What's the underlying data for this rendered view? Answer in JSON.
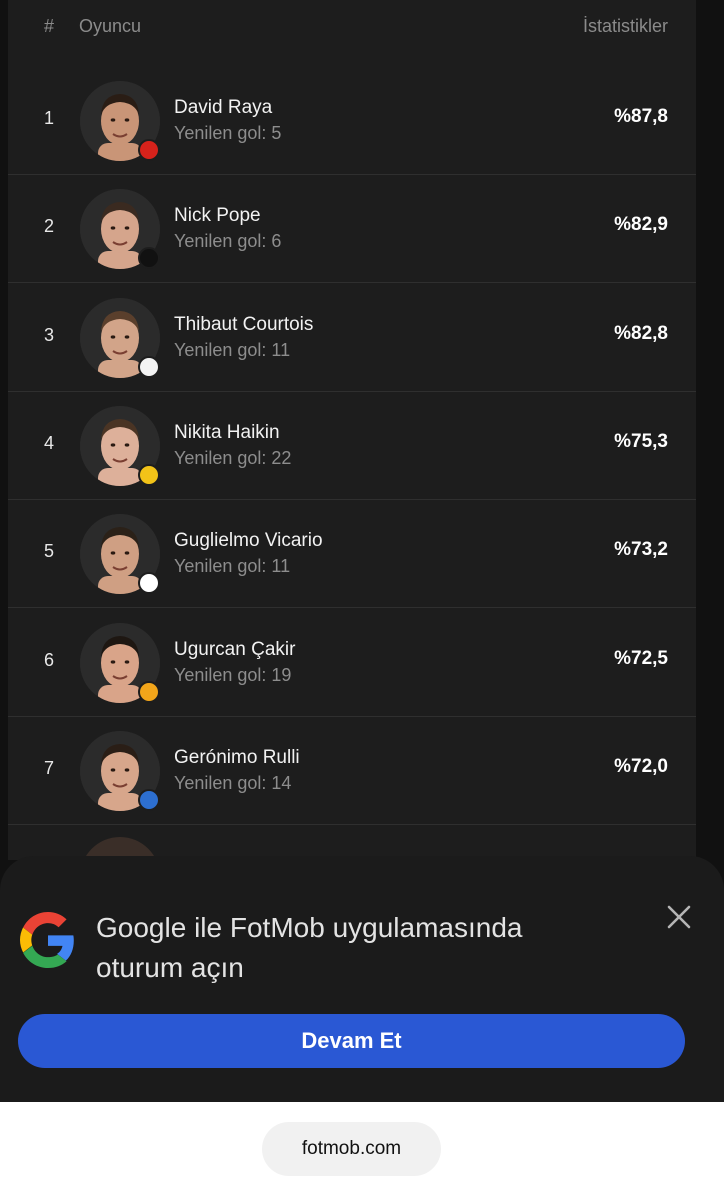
{
  "header": {
    "rank_label": "#",
    "player_label": "Oyuncu",
    "stats_label": "İstatistikler"
  },
  "row_sub_label": "Yenilen gol:",
  "players": [
    {
      "rank": "1",
      "name": "David Raya",
      "goals": "5",
      "stat": "%87,8",
      "skin": "#c99577",
      "hair": "#2a1d15",
      "badge_color": "#d6221b",
      "club_icon": "arsenal-badge-icon"
    },
    {
      "rank": "2",
      "name": "Nick Pope",
      "goals": "6",
      "stat": "%82,9",
      "skin": "#d5a58c",
      "hair": "#3a2a20",
      "badge_color": "#111111",
      "club_icon": "newcastle-badge-icon"
    },
    {
      "rank": "3",
      "name": "Thibaut Courtois",
      "goals": "11",
      "stat": "%82,8",
      "skin": "#d2a489",
      "hair": "#5a3f2c",
      "badge_color": "#f3f3f3",
      "club_icon": "real-madrid-badge-icon"
    },
    {
      "rank": "4",
      "name": "Nikita Haikin",
      "goals": "22",
      "stat": "%75,3",
      "skin": "#ddb09a",
      "hair": "#4a3424",
      "badge_color": "#f2c318",
      "club_icon": "bodo-glimt-badge-icon"
    },
    {
      "rank": "5",
      "name": "Guglielmo Vicario",
      "goals": "11",
      "stat": "%73,2",
      "skin": "#cf9f83",
      "hair": "#2b2118",
      "badge_color": "#ffffff",
      "club_icon": "tottenham-badge-icon"
    },
    {
      "rank": "6",
      "name": "Ugurcan Çakir",
      "goals": "19",
      "stat": "%72,5",
      "skin": "#d9a489",
      "hair": "#1e1712",
      "badge_color": "#f2a51a",
      "club_icon": "galatasaray-badge-icon"
    },
    {
      "rank": "7",
      "name": "Gerónimo Rulli",
      "goals": "14",
      "stat": "%72,0",
      "skin": "#d7a68b",
      "hair": "#2a1e16",
      "badge_color": "#2d6fd0",
      "club_icon": "marseille-badge-icon"
    }
  ],
  "login_sheet": {
    "title": "Google ile FotMob uygulamasında oturum açın",
    "continue_label": "Devam Et"
  },
  "browser": {
    "url": "fotmob.com"
  },
  "colors": {
    "background": "#111111",
    "card": "#1d1d1d",
    "accent_button": "#2a58d4",
    "muted_text": "#8d8d8d"
  }
}
